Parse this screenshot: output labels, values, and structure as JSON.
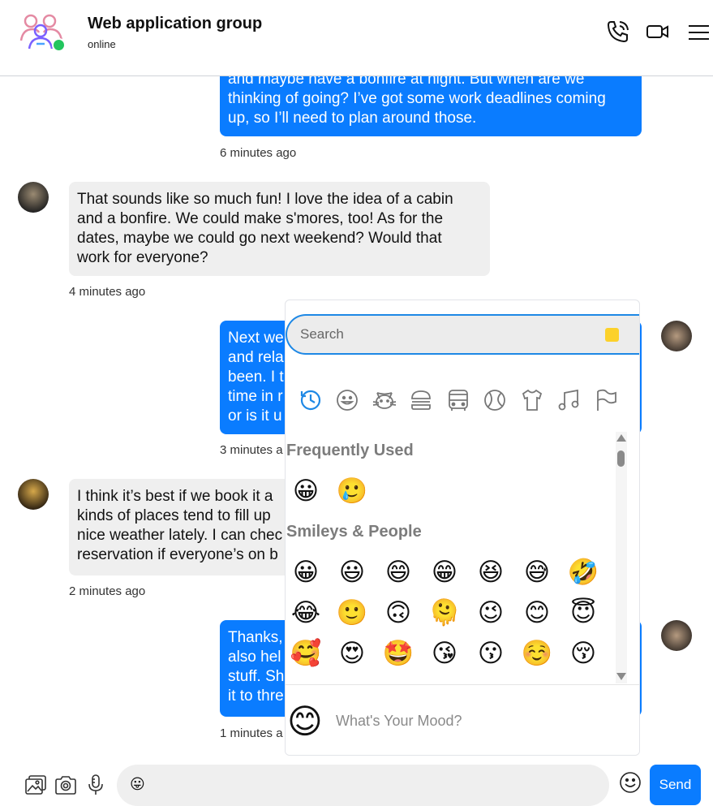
{
  "header": {
    "title": "Web application group",
    "status": "online",
    "icons": [
      "group-icon",
      "phone-icon",
      "video-icon",
      "menu-icon"
    ]
  },
  "messages": [
    {
      "side": "out",
      "text_lines": [
        "and maybe have a bonfire at night. But when are we",
        "thinking of going? I’ve got some work deadlines coming",
        "up, so I’ll need to plan around those."
      ],
      "time": "6 minutes ago"
    },
    {
      "side": "in",
      "text_lines": [
        "That sounds like so much fun! I love the idea of a cabin",
        "and a bonfire. We could make s'mores, too! As for the",
        "dates, maybe we could go next weekend? Would that",
        "work for everyone?"
      ],
      "time": "4 minutes ago"
    },
    {
      "side": "out",
      "text_lines": [
        "Next we",
        "and rela",
        "been. I t",
        "time in r",
        "or is it u"
      ],
      "time": "3 minutes a"
    },
    {
      "side": "in",
      "text_lines": [
        "I think it’s best if we book it a",
        "kinds of places tend to fill up",
        "nice weather lately. I can chec",
        "reservation if everyone’s on b"
      ],
      "time": "2 minutes ago"
    },
    {
      "side": "out",
      "text_lines": [
        "Thanks,",
        "also hel",
        "stuff. Sh",
        "it to thre"
      ],
      "time": "1 minutes a"
    }
  ],
  "emoji_picker": {
    "search_placeholder": "Search",
    "skin_tone_color": "#fcd12a",
    "categories": [
      "recent-icon",
      "smiley-icon",
      "cat-icon",
      "burger-icon",
      "bus-icon",
      "ball-icon",
      "shirt-icon",
      "music-icon",
      "flag-icon"
    ],
    "frequently_used_title": "Frequently Used",
    "frequently_used": [
      "😀",
      "🥲"
    ],
    "smileys_title": "Smileys & People",
    "smileys_rows": [
      [
        "😀",
        "😃",
        "😄",
        "😁",
        "😆",
        "😅",
        "🤣"
      ],
      [
        "😂",
        "🙂",
        "🙃",
        "🫠",
        "😉",
        "😊",
        "😇"
      ],
      [
        "🥰",
        "😍",
        "🤩",
        "😘",
        "😗",
        "☺️",
        "😚"
      ]
    ],
    "preview_emoji": "😊",
    "preview_text": "What's Your Mood?"
  },
  "composer": {
    "emoji": "😛",
    "send_label": "Send"
  },
  "colors": {
    "accent": "#0a7cff",
    "incoming_bubble": "#efefef",
    "online": "#22c55e"
  }
}
